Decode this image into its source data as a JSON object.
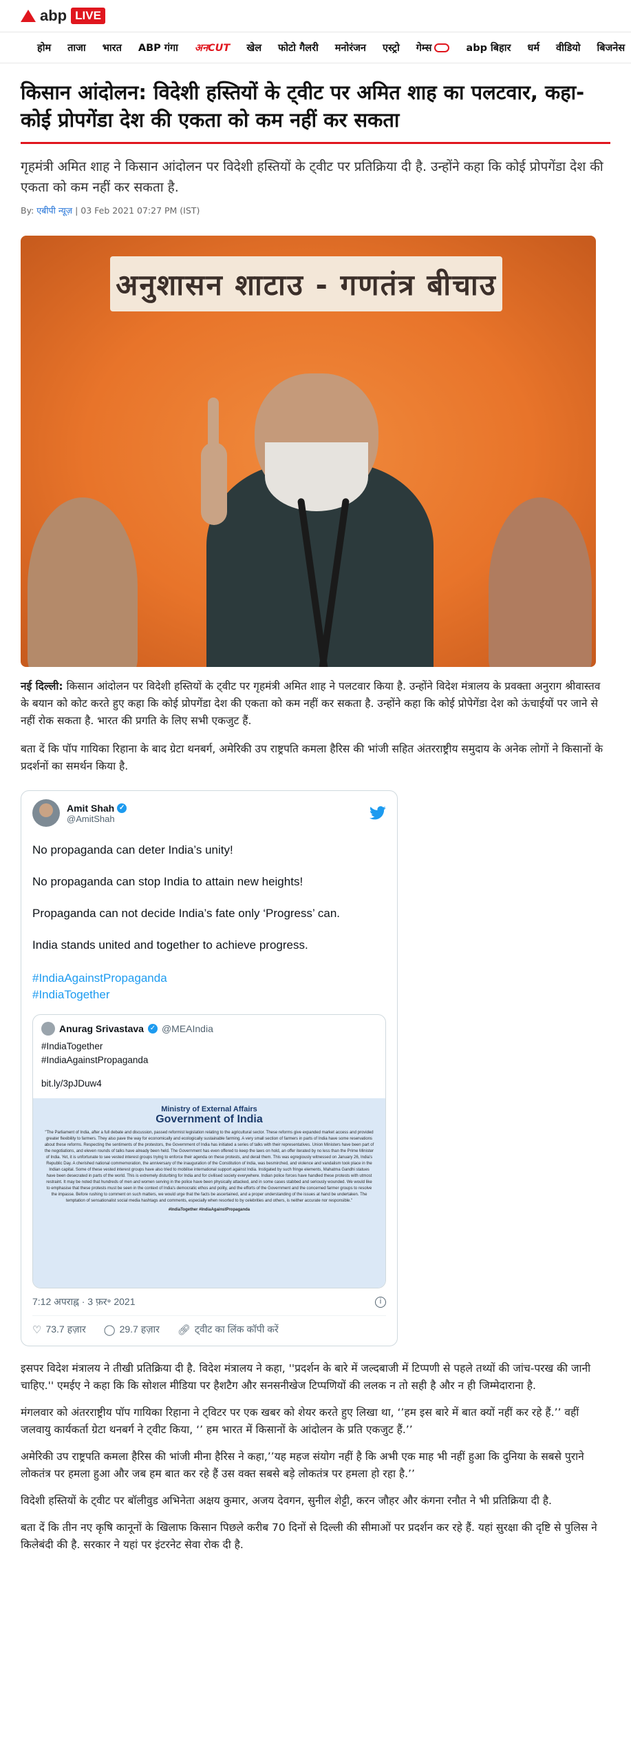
{
  "header": {
    "brand": "abp",
    "live": "LIVE"
  },
  "nav": {
    "items": [
      "होम",
      "ताजा",
      "भारत",
      "ABP गंगा",
      "अनCUT",
      "खेल",
      "फोटो गैलरी",
      "मनोरंजन",
      "एस्ट्रो",
      "गेम्स",
      "abp बिहार",
      "धर्म",
      "वीडियो",
      "बिजनेस"
    ]
  },
  "article": {
    "headline": "किसान आंदोलन: विदेशी हस्तियों के ट्वीट पर अमित शाह का पलटवार, कहा- कोई प्रोपगेंडा देश की एकता को कम नहीं कर सकता",
    "summary": "गृहमंत्री अमित शाह ने किसान आंदोलन पर विदेशी हस्तियों के ट्वीट पर प्रतिक्रिया दी है. उन्होंने कहा कि कोई प्रोपगेंडा देश की एकता को कम नहीं कर सकता है.",
    "byline_prefix": "By:",
    "author": "एबीपी न्यूज़",
    "date": "| 03 Feb 2021 07:27 PM (IST)",
    "hero_banner": "अनुशासन शाटाउ - गणतंत्र बीचाउ",
    "dateline": "नई दिल्ली:",
    "para1": "किसान आंदोलन पर विदेशी हस्तियों के ट्वीट पर गृहमंत्री अमित शाह ने पलटवार किया है. उन्होंने विदेश मंत्रालय के प्रवक्ता अनुराग श्रीवास्तव के बयान को कोट करते हुए कहा कि कोई प्रोपगेंडा देश की एकता को कम नहीं कर सकता है. उन्होंने कहा कि कोई प्रोपेगेंडा देश को ऊंचाईयों पर जाने से नहीं रोक सकता है. भारत की प्रगति के लिए सभी एकजुट हैं.",
    "para2": "बता दें कि पॉप गायिका रिहाना के बाद ग्रेटा थनबर्ग, अमेरिकी उप राष्ट्रपति कमला हैरिस की भांजी सहित अंतरराष्ट्रीय समुदाय के अनेक लोगों ने किसानों के प्रदर्शनों का समर्थन किया है.",
    "para3": "इसपर विदेश मंत्रालय ने तीखी प्रतिक्रिया दी है. विदेश मंत्रालय ने कहा, ''प्रदर्शन के बारे में जल्दबाजी में टिप्पणी से पहले तथ्यों की जांच-परख की जानी चाहिए.'' एमईए ने कहा कि कि सोशल मीडिया पर हैशटैग और सनसनीखेज टिप्पणियों की ललक न तो सही है और न ही जिम्मेदाराना है.",
    "para4": "मंगलवार को अंतरराष्ट्रीय पॉप गायिका रिहाना ने ट्विटर पर एक खबर को शेयर करते हुए लिखा था, ‘’हम इस बारे में बात क्यों नहीं कर रहे हैं.’’ वहीं जलवायु कार्यकर्ता ग्रेटा थनबर्ग ने ट्वीट किया, ‘’ हम भारत में किसानों के आंदोलन के प्रति एकजुट हैं.’’",
    "para5": "अमेरिकी उप राष्ट्रपति कमला हैरिस की भांजी मीना हैरिस ने कहा,’’यह महज संयोग नहीं है कि अभी एक माह भी नहीं हुआ कि दुनिया के सबसे पुराने लोकतंत्र पर हमला हुआ और जब हम बात कर रहे हैं उस वक्त सबसे बड़े लोकतंत्र पर हमला हो रहा है.’’",
    "para6": "विदेशी हस्तियों के ट्वीट पर बॉलीवुड अभिनेता अक्षय कुमार, अजय देवगन, सुनील शेट्टी, करन जौहर और कंगना रनौत ने भी प्रतिक्रिया दी है.",
    "para7": "बता दें कि तीन नए कृषि कानूनों के खिलाफ किसान पिछले करीब 70 दिनों से दिल्ली की सीमाओं पर प्रदर्शन कर रहे हैं. यहां सुरक्षा की दृष्टि से पुलिस ने किलेबंदी की है. सरकार ने यहां पर इंटरनेट सेवा रोक दी है."
  },
  "tweet": {
    "name": "Amit Shah",
    "handle": "@AmitShah",
    "lines": [
      "No propaganda can deter India’s unity!",
      "No propaganda can stop India to attain new heights!",
      "Propaganda can not decide India’s fate only ‘Progress’ can.",
      "India stands united and together to achieve progress."
    ],
    "hashtags": [
      "#IndiaAgainstPropaganda",
      "#IndiaTogether"
    ],
    "quoted": {
      "name": "Anurag Srivastava",
      "handle": "@MEAIndia",
      "lines": [
        "#IndiaTogether",
        "#IndiaAgainstPropaganda"
      ],
      "link": "bit.ly/3pJDuw4",
      "doc_ministry": "Ministry of External Affairs",
      "doc_gov": "Government of India",
      "doc_body": "\"The Parliament of India, after a full debate and discussion, passed reformist legislation relating to the agricultural sector. These reforms give expanded market access and provided greater flexibility to farmers. They also pave the way for economically and ecologically sustainable farming. A very small section of farmers in parts of India have some reservations about these reforms. Respecting the sentiments of the protestors, the Government of India has initiated a series of talks with their representatives. Union Ministers have been part of the negotiations, and eleven rounds of talks have already been held. The Government has even offered to keep the laws on hold, an offer iterated by no less than the Prime Minister of India. Yet, it is unfortunate to see vested interest groups trying to enforce their agenda on these protests, and derail them. This was egregiously witnessed on January 26, India's Republic Day. A cherished national commemoration, the anniversary of the inauguration of the Constitution of India, was besmirched, and violence and vandalism took place in the Indian capital. Some of these vested interest groups have also tried to mobilise international support against India. Instigated by such fringe elements, Mahatma Gandhi statues have been desecrated in parts of the world. This is extremely disturbing for India and for civilised society everywhere. Indian police forces have handled these protests with utmost restraint. It may be noted that hundreds of men and women serving in the police have been physically attacked, and in some cases stabbed and seriously wounded. We would like to emphasise that these protests must be seen in the context of India's democratic ethos and polity, and the efforts of the Government and the concerned farmer groups to resolve the impasse. Before rushing to comment on such matters, we would urge that the facts be ascertained, and a proper understanding of the issues at hand be undertaken. The temptation of sensationalist social media hashtags and comments, especially when resorted to by celebrities and others, is neither accurate nor responsible.\"",
      "doc_tags": "#IndiaTogether #IndiaAgainstPropaganda"
    },
    "time": "7:12 अपराह्न · 3 फ़र॰ 2021",
    "likes": "73.7 हज़ार",
    "retweets": "29.7 हज़ार",
    "copy_link": "ट्वीट का लिंक कॉपी करें"
  }
}
